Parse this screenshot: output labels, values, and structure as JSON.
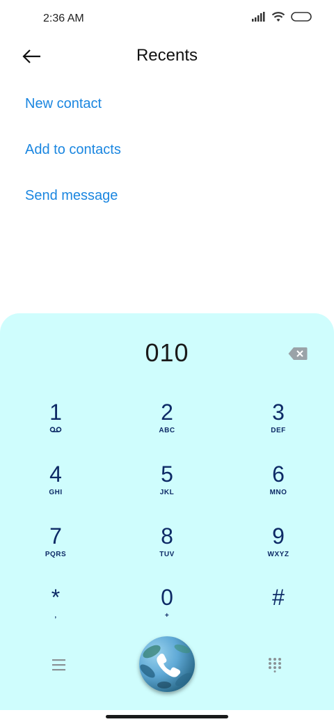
{
  "status_bar": {
    "time": "2:36 AM",
    "icons": [
      "signal-icon",
      "wifi-icon",
      "battery-icon"
    ]
  },
  "header": {
    "title": "Recents",
    "back_icon": "back-arrow-icon"
  },
  "actions": [
    {
      "label": "New contact"
    },
    {
      "label": "Add to contacts"
    },
    {
      "label": "Send message"
    }
  ],
  "dialer": {
    "number": "010",
    "backspace_icon": "backspace-icon",
    "keys": [
      {
        "digit": "1",
        "letters": "ᴑᴑ",
        "name": "key-1"
      },
      {
        "digit": "2",
        "letters": "ABC",
        "name": "key-2"
      },
      {
        "digit": "3",
        "letters": "DEF",
        "name": "key-3"
      },
      {
        "digit": "4",
        "letters": "GHI",
        "name": "key-4"
      },
      {
        "digit": "5",
        "letters": "JKL",
        "name": "key-5"
      },
      {
        "digit": "6",
        "letters": "MNO",
        "name": "key-6"
      },
      {
        "digit": "7",
        "letters": "PQRS",
        "name": "key-7"
      },
      {
        "digit": "8",
        "letters": "TUV",
        "name": "key-8"
      },
      {
        "digit": "9",
        "letters": "WXYZ",
        "name": "key-9"
      },
      {
        "digit": "*",
        "letters": ",",
        "name": "key-star"
      },
      {
        "digit": "0",
        "letters": "+",
        "name": "key-0"
      },
      {
        "digit": "#",
        "letters": "",
        "name": "key-hash"
      }
    ],
    "menu_icon": "menu-icon",
    "call_icon": "phone-icon",
    "keypad_icon": "dialpad-icon"
  },
  "colors": {
    "accent": "#1a86e0",
    "dialer_bg": "#cffdfd",
    "key_text": "#0d2a66"
  }
}
